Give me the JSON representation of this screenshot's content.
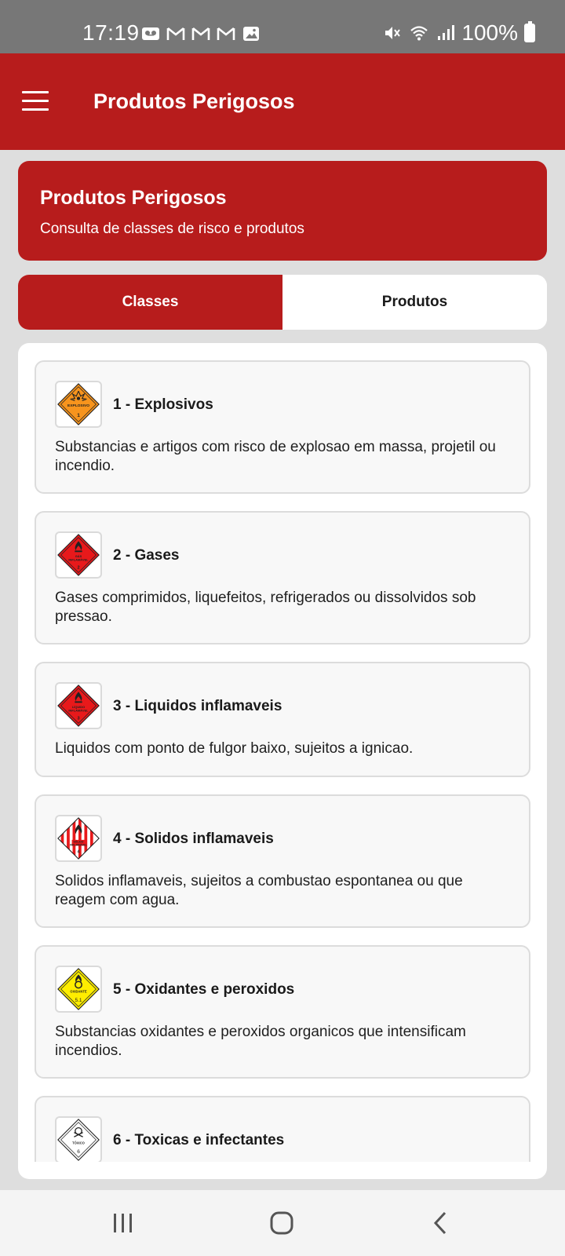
{
  "status_bar": {
    "time": "17:19",
    "battery": "100%"
  },
  "app_bar": {
    "title": "Produtos Perigosos"
  },
  "header": {
    "title": "Produtos Perigosos",
    "subtitle": "Consulta de classes de risco e produtos"
  },
  "tabs": [
    {
      "label": "Classes",
      "active": true
    },
    {
      "label": "Produtos",
      "active": false
    }
  ],
  "classes": [
    {
      "title": "1 - Explosivos",
      "description": "Substancias e artigos com risco de explosao em massa, projetil ou incendio.",
      "icon": "explosive-placard-icon",
      "color": "#f7941d",
      "placard_text": "EXPLOSIVO",
      "placard_number": "1"
    },
    {
      "title": "2 - Gases",
      "description": "Gases comprimidos, liquefeitos, refrigerados ou dissolvidos sob pressao.",
      "icon": "flammable-gas-placard-icon",
      "color": "#e8191b",
      "placard_text": "GÁS INFLAMÁVEL",
      "placard_number": "2"
    },
    {
      "title": "3 - Liquidos inflamaveis",
      "description": "Liquidos com ponto de fulgor baixo, sujeitos a ignicao.",
      "icon": "flammable-liquid-placard-icon",
      "color": "#e8191b",
      "placard_text": "LÍQUIDO INFLAMÁVEL",
      "placard_number": "3"
    },
    {
      "title": "4 - Solidos inflamaveis",
      "description": "Solidos inflamaveis, sujeitos a combustao espontanea ou que reagem com agua.",
      "icon": "flammable-solid-placard-icon",
      "color": "#e8191b",
      "placard_text": "SÓLIDO INFLAMÁVEL",
      "placard_number": "4"
    },
    {
      "title": "5 - Oxidantes e peroxidos",
      "description": "Substancias oxidantes e peroxidos organicos que intensificam incendios.",
      "icon": "oxidizer-placard-icon",
      "color": "#ffee00",
      "placard_text": "OXIDANTE",
      "placard_number": "5.1"
    },
    {
      "title": "6 - Toxicas e infectantes",
      "description": "",
      "icon": "toxic-placard-icon",
      "color": "#ffffff",
      "placard_text": "TÓXICO",
      "placard_number": "6"
    }
  ],
  "colors": {
    "brand_red": "#b71c1c",
    "status_bar": "#777777",
    "background": "#dedede"
  }
}
